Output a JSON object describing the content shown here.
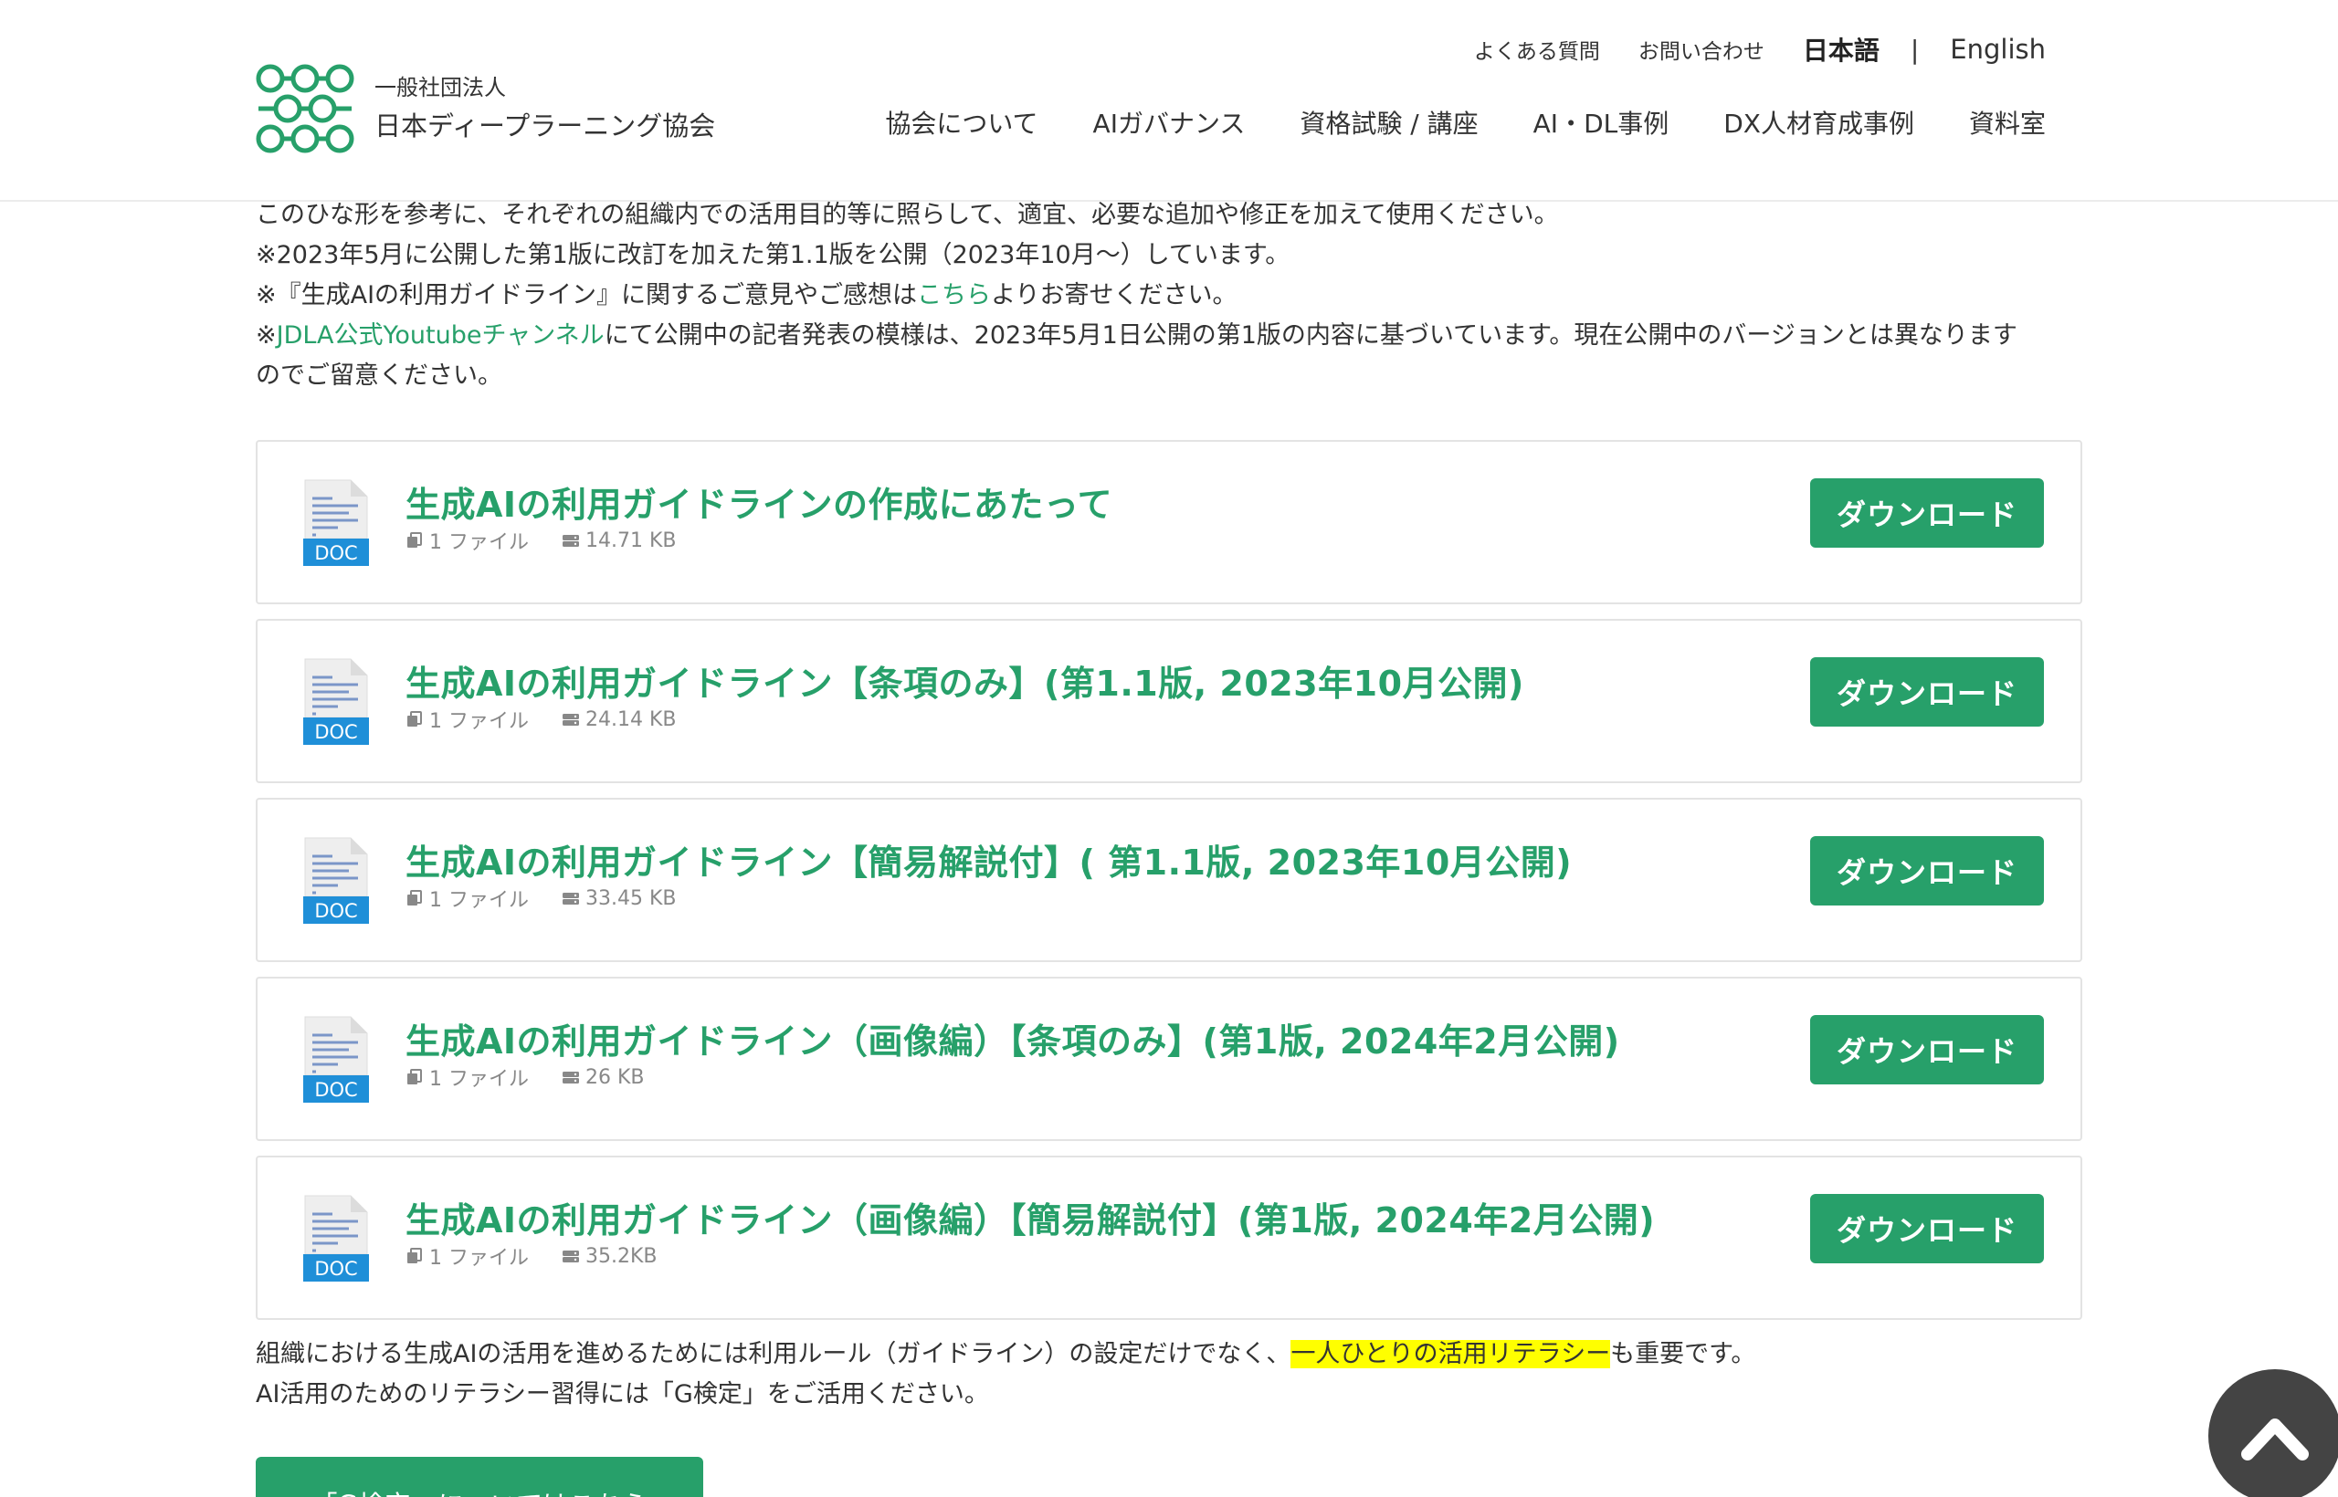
{
  "header": {
    "org_type": "一般社団法人",
    "org_name": "日本ディープラーニング協会",
    "utility": {
      "faq": "よくある質問",
      "contact": "お問い合わせ",
      "lang_ja": "日本語",
      "separator": "|",
      "lang_en": "English"
    },
    "nav": [
      {
        "label": "協会について"
      },
      {
        "label": "AIガバナンス"
      },
      {
        "label": "資格試験 / 講座"
      },
      {
        "label": "AI・DL事例"
      },
      {
        "label": "DX人材育成事例"
      },
      {
        "label": "資料室"
      }
    ]
  },
  "intro": {
    "line1": "このひな形を参考に、それぞれの組織内での活用目的等に照らして、適宜、必要な追加や修正を加えて使用ください。",
    "line2": "※2023年5月に公開した第1版に改訂を加えた第1.1版を公開（2023年10月〜）しています。",
    "line3_pre": "※『生成AIの利用ガイドライン』に関するご意見やご感想は",
    "line3_link": "こちら",
    "line3_post": "よりお寄せください。",
    "line4_pre": "※",
    "line4_link": "JDLA公式Youtubeチャンネル",
    "line4_post": "にて公開中の記者発表の模様は、2023年5月1日公開の第1版の内容に基づいています。現在公開中のバージョンとは異なります",
    "line5": "のでご留意ください。"
  },
  "downloads": [
    {
      "title": "生成AIの利用ガイドラインの作成にあたって",
      "files": "1 ファイル",
      "size": "14.71 KB",
      "button": "ダウンロード",
      "icon_label": "DOC"
    },
    {
      "title": "生成AIの利用ガイドライン【条項のみ】(第1.1版, 2023年10月公開)",
      "files": "1 ファイル",
      "size": "24.14 KB",
      "button": "ダウンロード",
      "icon_label": "DOC"
    },
    {
      "title": "生成AIの利用ガイドライン【簡易解説付】( 第1.1版, 2023年10月公開)",
      "files": "1 ファイル",
      "size": "33.45 KB",
      "button": "ダウンロード",
      "icon_label": "DOC"
    },
    {
      "title": "生成AIの利用ガイドライン（画像編）【条項のみ】(第1版, 2024年2月公開)",
      "files": "1 ファイル",
      "size": "26 KB",
      "button": "ダウンロード",
      "icon_label": "DOC"
    },
    {
      "title": "生成AIの利用ガイドライン（画像編）【簡易解説付】(第1版, 2024年2月公開)",
      "files": "1 ファイル",
      "size": "35.2KB",
      "button": "ダウンロード",
      "icon_label": "DOC"
    }
  ],
  "outro": {
    "line1_pre": "組織における生成AIの活用を進めるためには利用ルール（ガイドライン）の設定だけでなく、",
    "line1_highlight": "一人ひとりの活用リテラシー",
    "line1_post": "も重要です。",
    "line2": "AI活用のためのリテラシー習得には「G検定」をご活用ください。"
  },
  "g_button": "「G検定」についてはこちら",
  "colors": {
    "accent": "#27a06a",
    "highlight": "#ffff00",
    "doc_badge": "#1f8fd8",
    "scroll_top": "#444444"
  },
  "icons": {
    "logo": "network-logo-icon",
    "doc": "doc-file-icon",
    "files": "files-icon",
    "size": "storage-icon",
    "scroll_top": "chevron-up-icon"
  }
}
